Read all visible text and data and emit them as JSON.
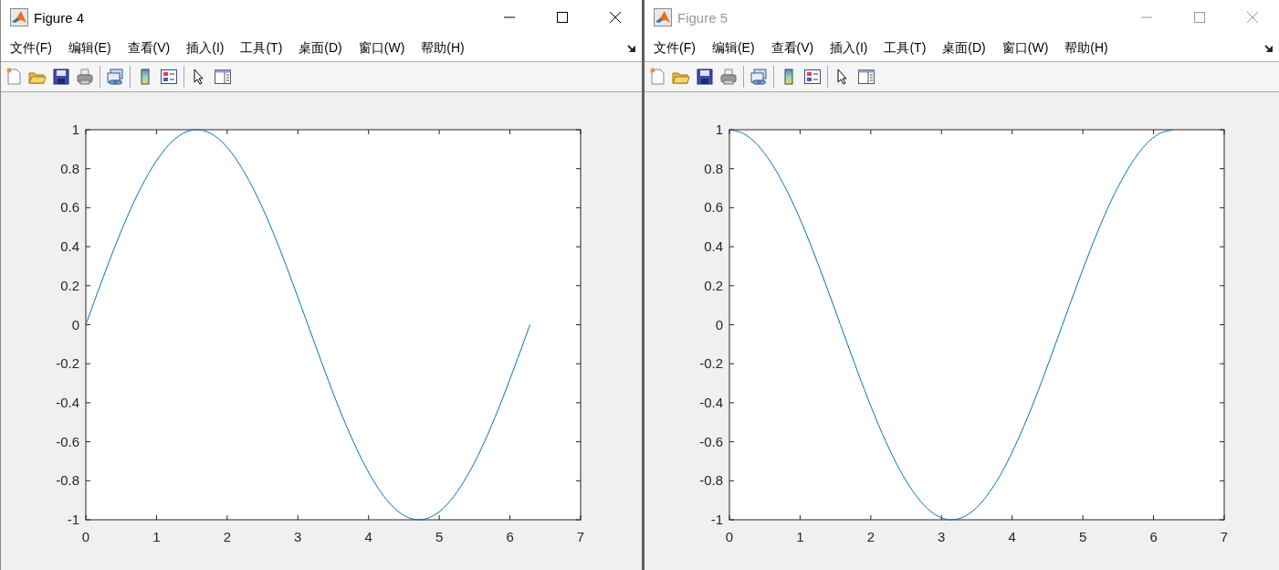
{
  "windows": [
    {
      "title": "Figure 4",
      "active": true,
      "menu": [
        "文件(F)",
        "编辑(E)",
        "查看(V)",
        "插入(I)",
        "工具(T)",
        "桌面(D)",
        "窗口(W)",
        "帮助(H)"
      ],
      "chart_data": {
        "type": "line",
        "x": [
          0,
          0.196,
          0.393,
          0.589,
          0.785,
          0.982,
          1.178,
          1.374,
          1.571,
          1.767,
          1.963,
          2.16,
          2.356,
          2.553,
          2.749,
          2.945,
          3.142,
          3.338,
          3.534,
          3.731,
          3.927,
          4.123,
          4.32,
          4.516,
          4.712,
          4.909,
          5.105,
          5.301,
          5.498,
          5.694,
          5.89,
          6.087,
          6.283
        ],
        "series": [
          {
            "color": "#0072bd",
            "values": [
              0,
              0.195,
              0.383,
              0.556,
              0.707,
              0.831,
              0.924,
              0.981,
              1,
              0.981,
              0.924,
              0.831,
              0.707,
              0.556,
              0.383,
              0.195,
              0,
              -0.195,
              -0.383,
              -0.556,
              -0.707,
              -0.831,
              -0.924,
              -0.981,
              -1,
              -0.981,
              -0.924,
              -0.831,
              -0.707,
              -0.556,
              -0.383,
              -0.195,
              0
            ]
          }
        ],
        "xlim": [
          0,
          7
        ],
        "ylim": [
          -1,
          1
        ],
        "xticks": [
          0,
          1,
          2,
          3,
          4,
          5,
          6,
          7
        ],
        "yticks": [
          -1,
          -0.8,
          -0.6,
          -0.4,
          -0.2,
          0,
          0.2,
          0.4,
          0.6,
          0.8,
          1
        ]
      }
    },
    {
      "title": "Figure 5",
      "active": false,
      "menu": [
        "文件(F)",
        "编辑(E)",
        "查看(V)",
        "插入(I)",
        "工具(T)",
        "桌面(D)",
        "窗口(W)",
        "帮助(H)"
      ],
      "chart_data": {
        "type": "line",
        "x": [
          0,
          0.196,
          0.393,
          0.589,
          0.785,
          0.982,
          1.178,
          1.374,
          1.571,
          1.767,
          1.963,
          2.16,
          2.356,
          2.553,
          2.749,
          2.945,
          3.142,
          3.338,
          3.534,
          3.731,
          3.927,
          4.123,
          4.32,
          4.516,
          4.712,
          4.909,
          5.105,
          5.301,
          5.498,
          5.694,
          5.89,
          6.087,
          6.283
        ],
        "series": [
          {
            "color": "#0072bd",
            "values": [
              1,
              0.981,
              0.924,
              0.831,
              0.707,
              0.556,
              0.383,
              0.195,
              0,
              -0.195,
              -0.383,
              -0.556,
              -0.707,
              -0.831,
              -0.924,
              -0.981,
              -1,
              -0.981,
              -0.924,
              -0.831,
              -0.707,
              -0.556,
              -0.383,
              -0.195,
              0,
              0.195,
              0.383,
              0.556,
              0.707,
              0.831,
              0.924,
              0.981,
              1
            ]
          }
        ],
        "xlim": [
          0,
          7
        ],
        "ylim": [
          -1,
          1
        ],
        "xticks": [
          0,
          1,
          2,
          3,
          4,
          5,
          6,
          7
        ],
        "yticks": [
          -1,
          -0.8,
          -0.6,
          -0.4,
          -0.2,
          0,
          0.2,
          0.4,
          0.6,
          0.8,
          1
        ]
      }
    }
  ]
}
